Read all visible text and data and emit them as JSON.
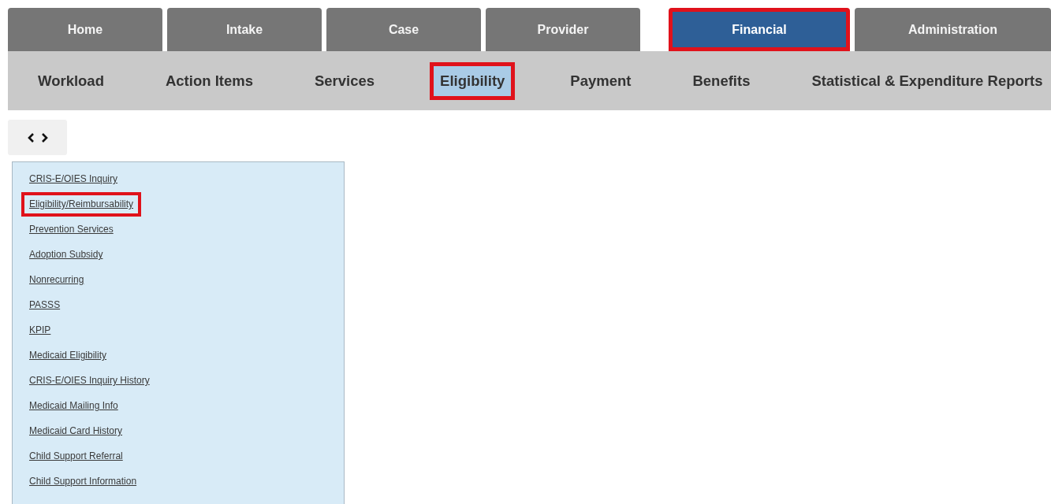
{
  "main_tabs": [
    {
      "label": "Home",
      "selected": false,
      "highlighted": false
    },
    {
      "label": "Intake",
      "selected": false,
      "highlighted": false
    },
    {
      "label": "Case",
      "selected": false,
      "highlighted": false
    },
    {
      "label": "Provider",
      "selected": false,
      "highlighted": false
    },
    {
      "label": "Financial",
      "selected": true,
      "highlighted": true
    },
    {
      "label": "Administration",
      "selected": false,
      "highlighted": false
    }
  ],
  "sub_tabs": [
    {
      "label": "Workload",
      "selected": false,
      "highlighted": false
    },
    {
      "label": "Action Items",
      "selected": false,
      "highlighted": false
    },
    {
      "label": "Services",
      "selected": false,
      "highlighted": false
    },
    {
      "label": "Eligibility",
      "selected": true,
      "highlighted": true
    },
    {
      "label": "Payment",
      "selected": false,
      "highlighted": false
    },
    {
      "label": "Benefits",
      "selected": false,
      "highlighted": false
    },
    {
      "label": "Statistical & Expenditure Reports",
      "selected": false,
      "highlighted": false
    }
  ],
  "side_menu": [
    {
      "label": "CRIS-E/OIES Inquiry",
      "highlighted": false
    },
    {
      "label": "Eligibility/Reimbursability",
      "highlighted": true
    },
    {
      "label": "Prevention Services",
      "highlighted": false
    },
    {
      "label": "Adoption Subsidy",
      "highlighted": false
    },
    {
      "label": "Nonrecurring",
      "highlighted": false
    },
    {
      "label": "PASSS",
      "highlighted": false
    },
    {
      "label": "KPIP",
      "highlighted": false
    },
    {
      "label": "Medicaid Eligibility",
      "highlighted": false
    },
    {
      "label": "CRIS-E/OIES Inquiry History",
      "highlighted": false
    },
    {
      "label": "Medicaid Mailing Info",
      "highlighted": false
    },
    {
      "label": "Medicaid Card History",
      "highlighted": false
    },
    {
      "label": "Child Support Referral",
      "highlighted": false
    },
    {
      "label": "Child Support Information",
      "highlighted": false
    }
  ]
}
